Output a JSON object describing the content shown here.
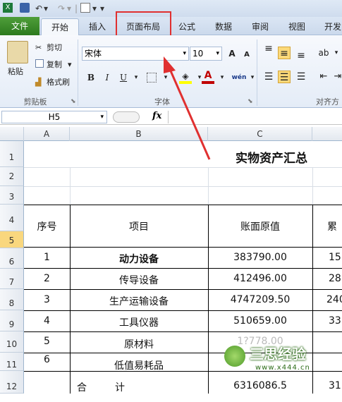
{
  "qat": {
    "dropdown_glyph": "▾",
    "separator": "|"
  },
  "tabs": {
    "file": "文件",
    "home": "开始",
    "insert": "插入",
    "page_layout": "页面布局",
    "formulas": "公式",
    "data": "数据",
    "review": "审阅",
    "view": "视图",
    "developer": "开发"
  },
  "clipboard": {
    "paste": "粘贴",
    "cut": "剪切",
    "copy": "复制",
    "format_painter": "格式刷",
    "group": "剪贴板"
  },
  "font": {
    "name": "宋体",
    "size": "10",
    "group": "字体",
    "bold": "B",
    "italic": "I",
    "underline": "U",
    "font_color_letter": "A",
    "grow": "A",
    "shrink": "A",
    "phonetic": "wén",
    "font_color": "#c00000",
    "fill_color": "#ffff00"
  },
  "align": {
    "group": "对齐方"
  },
  "formula_bar": {
    "cell_ref": "H5",
    "fx": "fx"
  },
  "columns": [
    "A",
    "B",
    "C"
  ],
  "rows": [
    "1",
    "2",
    "3",
    "4",
    "5",
    "6",
    "7",
    "8",
    "9",
    "10",
    "11",
    "12"
  ],
  "sheet": {
    "title": "实物资产汇总",
    "headers": {
      "seq": "序号",
      "item": "项目",
      "book_value": "账面原值",
      "next": "累"
    },
    "data": [
      {
        "seq": "1",
        "item": "动力设备",
        "value": "383790.00",
        "next": "15"
      },
      {
        "seq": "2",
        "item": "传导设备",
        "value": "412496.00",
        "next": "28"
      },
      {
        "seq": "3",
        "item": "生产运输设备",
        "value": "4747209.50",
        "next": "240"
      },
      {
        "seq": "4",
        "item": "工具仪器",
        "value": "510659.00",
        "next": "33"
      },
      {
        "seq": "5",
        "item": "原材料",
        "value": "1?778.00",
        "next": ""
      },
      {
        "seq": "6",
        "item": "低值易耗品",
        "value": "",
        "next": ""
      }
    ],
    "total_label_1": "合",
    "total_label_2": "计",
    "total_value": "6316086.5",
    "total_next": "31"
  },
  "watermark": {
    "brand": "三思经验",
    "url": "www.x444.cn"
  },
  "colors": {
    "file_tab": "#2c7a1e",
    "highlight_box": "#e03030",
    "selected_align": "#fbd97a"
  }
}
